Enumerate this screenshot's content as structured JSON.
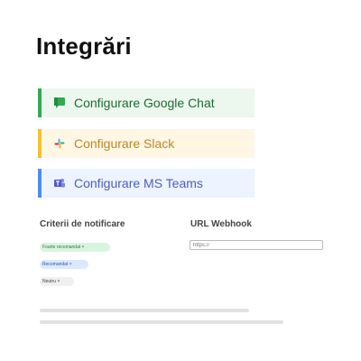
{
  "page": {
    "title": "Integrări"
  },
  "integrations": [
    {
      "label": "Configurare Google Chat",
      "icon": "google-chat-icon",
      "accent": "#34a853",
      "background": "#ecf7ee"
    },
    {
      "label": "Configurare Slack",
      "icon": "slack-icon",
      "accent": "#f2c230",
      "background": "#fff7e3"
    },
    {
      "label": "Configurare MS Teams",
      "icon": "ms-teams-icon",
      "accent": "#4f8cf0",
      "background": "#edf3ff"
    }
  ],
  "notification_criteria": {
    "label": "Criterii de notificare",
    "chips": [
      {
        "label": "Foarte recomandat ×",
        "color": "#d8f5de"
      },
      {
        "label": "Recomandat ×",
        "color": "#dbe8ff"
      },
      {
        "label": "Neutru ×",
        "color": "#f0f0f0"
      }
    ]
  },
  "webhook": {
    "label": "URL Webhook",
    "placeholder": "https://",
    "value": ""
  }
}
